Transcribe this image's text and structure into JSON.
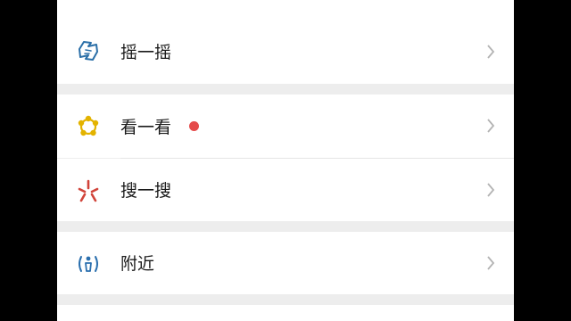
{
  "menu": {
    "items": [
      {
        "label": "摇一摇",
        "icon": "shake-icon"
      },
      {
        "label": "看一看",
        "icon": "top-stories-icon",
        "badge": "red-dot"
      },
      {
        "label": "搜一搜",
        "icon": "search-icon"
      },
      {
        "label": "附近",
        "icon": "nearby-icon"
      }
    ]
  },
  "colors": {
    "shake": "#2b6fa8",
    "look": "#e3b300",
    "search": "#d1443a",
    "nearby": "#2a6fae",
    "badge": "#e54b4b",
    "chevron": "#b3b3b3",
    "background": "#ededed"
  }
}
